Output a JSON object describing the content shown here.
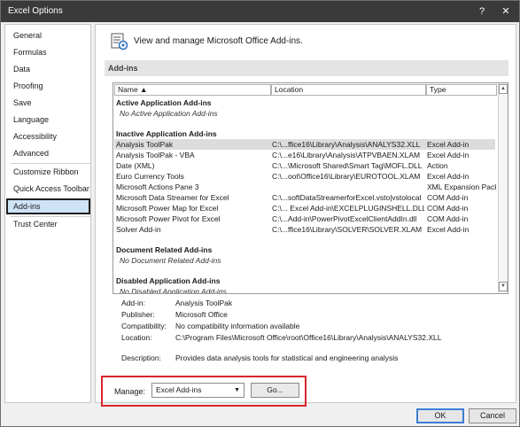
{
  "window": {
    "title": "Excel Options",
    "help": "?",
    "close": "✕"
  },
  "nav": {
    "items": [
      {
        "label": "General"
      },
      {
        "label": "Formulas"
      },
      {
        "label": "Data"
      },
      {
        "label": "Proofing"
      },
      {
        "label": "Save"
      },
      {
        "label": "Language"
      },
      {
        "label": "Accessibility"
      },
      {
        "label": "Advanced"
      },
      {
        "label": "Customize Ribbon"
      },
      {
        "label": "Quick Access Toolbar"
      },
      {
        "label": "Add-ins"
      },
      {
        "label": "Trust Center"
      }
    ],
    "selected": "Add-ins"
  },
  "header": {
    "text": "View and manage Microsoft Office Add-ins."
  },
  "section": {
    "title": "Add-ins"
  },
  "list": {
    "columns": {
      "name": "Name ▲",
      "location": "Location",
      "type": "Type"
    },
    "groups": {
      "active": {
        "title": "Active Application Add-ins",
        "empty": "No Active Application Add-ins"
      },
      "inactive": {
        "title": "Inactive Application Add-ins"
      },
      "document": {
        "title": "Document Related Add-ins",
        "empty": "No Document Related Add-ins"
      },
      "disabled": {
        "title": "Disabled Application Add-ins",
        "empty": "No Disabled Application Add-ins"
      }
    },
    "inactive_rows": [
      {
        "name": "Analysis ToolPak",
        "location": "C:\\...ffice16\\Library\\Analysis\\ANALYS32.XLL",
        "type": "Excel Add-in"
      },
      {
        "name": "Analysis ToolPak - VBA",
        "location": "C:\\...e16\\Library\\Analysis\\ATPVBAEN.XLAM",
        "type": "Excel Add-in"
      },
      {
        "name": "Date (XML)",
        "location": "C:\\...\\Microsoft Shared\\Smart Tag\\MOFL.DLL",
        "type": "Action"
      },
      {
        "name": "Euro Currency Tools",
        "location": "C:\\...oot\\Office16\\Library\\EUROTOOL.XLAM",
        "type": "Excel Add-in"
      },
      {
        "name": "Microsoft Actions Pane 3",
        "location": "",
        "type": "XML Expansion Pack"
      },
      {
        "name": "Microsoft Data Streamer for Excel",
        "location": "C:\\...softDataStreamerforExcel.vsto|vstolocal",
        "type": "COM Add-in"
      },
      {
        "name": "Microsoft Power Map for Excel",
        "location": "C:\\... Excel Add-in\\EXCELPLUGINSHELL.DLL",
        "type": "COM Add-in"
      },
      {
        "name": "Microsoft Power Pivot for Excel",
        "location": "C:\\...Add-in\\PowerPivotExcelClientAddIn.dll",
        "type": "COM Add-in"
      },
      {
        "name": "Solver Add-in",
        "location": "C:\\...ffice16\\Library\\SOLVER\\SOLVER.XLAM",
        "type": "Excel Add-in"
      }
    ],
    "scroll_up": "▲",
    "scroll_down": "▼"
  },
  "details": {
    "addin_label": "Add-in:",
    "addin_value": "Analysis ToolPak",
    "publisher_label": "Publisher:",
    "publisher_value": "Microsoft Office",
    "compat_label": "Compatibility:",
    "compat_value": "No compatibility information available",
    "location_label": "Location:",
    "location_value": "C:\\Program Files\\Microsoft Office\\root\\Office16\\Library\\Analysis\\ANALYS32.XLL",
    "description_label": "Description:",
    "description_value": "Provides data analysis tools for statistical and engineering analysis"
  },
  "manage": {
    "label": "Manage:",
    "selected": "Excel Add-ins",
    "arrow": "▼",
    "go": "Go..."
  },
  "footer": {
    "ok": "OK",
    "cancel": "Cancel"
  },
  "colors": {
    "titlebar": "#3a3a3a",
    "highlight": "#d8262c",
    "selected_nav": "#cfe3f7",
    "ok_border": "#3c7fd6"
  }
}
